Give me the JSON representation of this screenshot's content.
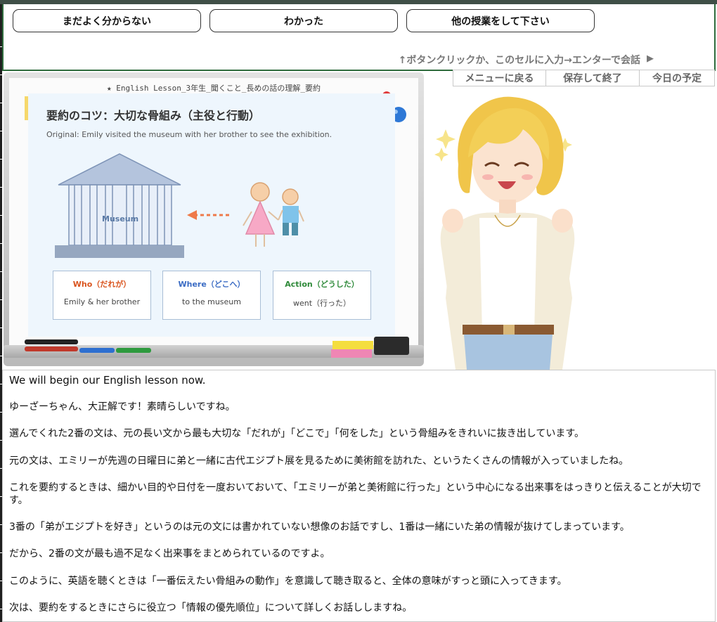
{
  "choices": [
    "まだよく分からない",
    "わかった",
    "他の授業をして下さい"
  ],
  "hint": "↑ボタンクリックか、このセルに入力→エンターで会話",
  "hint_arrow": "▶",
  "nav": [
    "メニューに戻る",
    "保存して終了",
    "今日の予定"
  ],
  "board": {
    "title": "★ English Lesson_3年生_聞くこと_長めの話の理解_要約",
    "heading": "要約のコツ：大切な骨組み（主役と行動）",
    "original": "Original: Emily visited the museum with her brother to see the exhibition.",
    "museum_label": "Museum",
    "boxes": [
      {
        "label": "Who（だれが）",
        "value": "Emily & her brother",
        "color": "#d9541e"
      },
      {
        "label": "Where（どこへ）",
        "value": "to the museum",
        "color": "#3b6cc4"
      },
      {
        "label": "Action（どうした）",
        "value": "went（行った）",
        "color": "#2f8a3a"
      }
    ]
  },
  "messages": [
    "We will begin our English lesson now.",
    "ゆーざーちゃん、大正解です！素晴らしいですね。",
    "選んでくれた2番の文は、元の長い文から最も大切な「だれが」「どこで」「何をした」という骨組みをきれいに抜き出しています。",
    "元の文は、エミリーが先週の日曜日に弟と一緒に古代エジプト展を見るために美術館を訪れた、というたくさんの情報が入っていましたね。",
    "これを要約するときは、細かい目的や日付を一度おいておいて、「エミリーが弟と美術館に行った」という中心になる出来事をはっきりと伝えることが大切です。",
    "3番の「弟がエジプトを好き」というのは元の文には書かれていない想像のお話ですし、1番は一緒にいた弟の情報が抜けてしまっています。",
    "だから、2番の文が最も過不足なく出来事をまとめられているのですよ。",
    "このように、英語を聴くときは「一番伝えたい骨組みの動作」を意識して聴き取ると、全体の意味がすっと頭に入ってきます。",
    "次は、要約をするときにさらに役立つ「情報の優先順位」について詳しくお話ししますね。"
  ]
}
